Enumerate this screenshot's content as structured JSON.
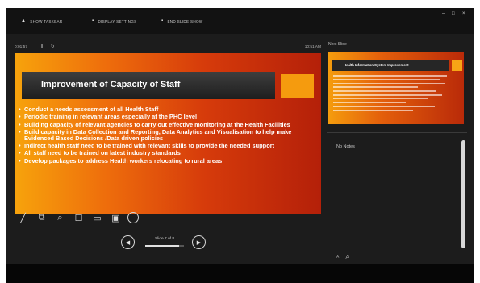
{
  "toolbar": {
    "buttons": [
      {
        "label": "Show Taskbar",
        "icon": "taskbar-icon",
        "glyph": "▲"
      },
      {
        "label": "Display Settings",
        "icon": "display-settings-icon",
        "glyph": "▪"
      },
      {
        "label": "End Slide Show",
        "icon": "end-show-icon",
        "glyph": "▪"
      }
    ],
    "window_controls": {
      "minimize": "–",
      "restore": "□",
      "close": "×"
    }
  },
  "presenter": {
    "timer": "0:01:57",
    "pause_glyph": "‖",
    "reset_glyph": "↻",
    "clock": "10:51 AM"
  },
  "slide": {
    "title": "Improvement of Capacity of Staff",
    "bullets": [
      "Conduct a needs assessment of all Health Staff",
      "Periodic training in relevant areas especially at the PHC level",
      "Building capacity of relevant agencies to carry out effective monitoring at the Health Facilities",
      "Build capacity in Data Collection and Reporting, Data Analytics and Visualisation to help make Evidenced Based Decisions /Data driven policies",
      "Indirect health staff need to be trained with relevant skills to provide the needed support",
      "All staff need to be trained on latest industry standards",
      "Develop packages to address Health workers relocating to rural areas"
    ],
    "colors": {
      "gradient_start": "#f7a30c",
      "gradient_end": "#b42009",
      "title_bar": "#2a2a2a",
      "accent": "#f59b0e"
    }
  },
  "tools": [
    {
      "name": "pen-icon",
      "glyph": "╱"
    },
    {
      "name": "see-all-slides-icon",
      "glyph": "⧉"
    },
    {
      "name": "zoom-icon",
      "glyph": "⌕"
    },
    {
      "name": "pointer-icon",
      "glyph": "☐"
    },
    {
      "name": "black-screen-icon",
      "glyph": "▭"
    },
    {
      "name": "subtitles-icon",
      "glyph": "▣"
    },
    {
      "name": "more-options-icon",
      "glyph": "⋯"
    }
  ],
  "navigation": {
    "prev_glyph": "◀",
    "next_glyph": "▶",
    "counter": "Slide 7 of 8",
    "progress": 0.875
  },
  "next_slide": {
    "label": "Next Slide",
    "title": "Health Information System Improvement"
  },
  "notes": {
    "text": "No Notes"
  },
  "zoom": {
    "decrease": "A",
    "increase": "A"
  }
}
